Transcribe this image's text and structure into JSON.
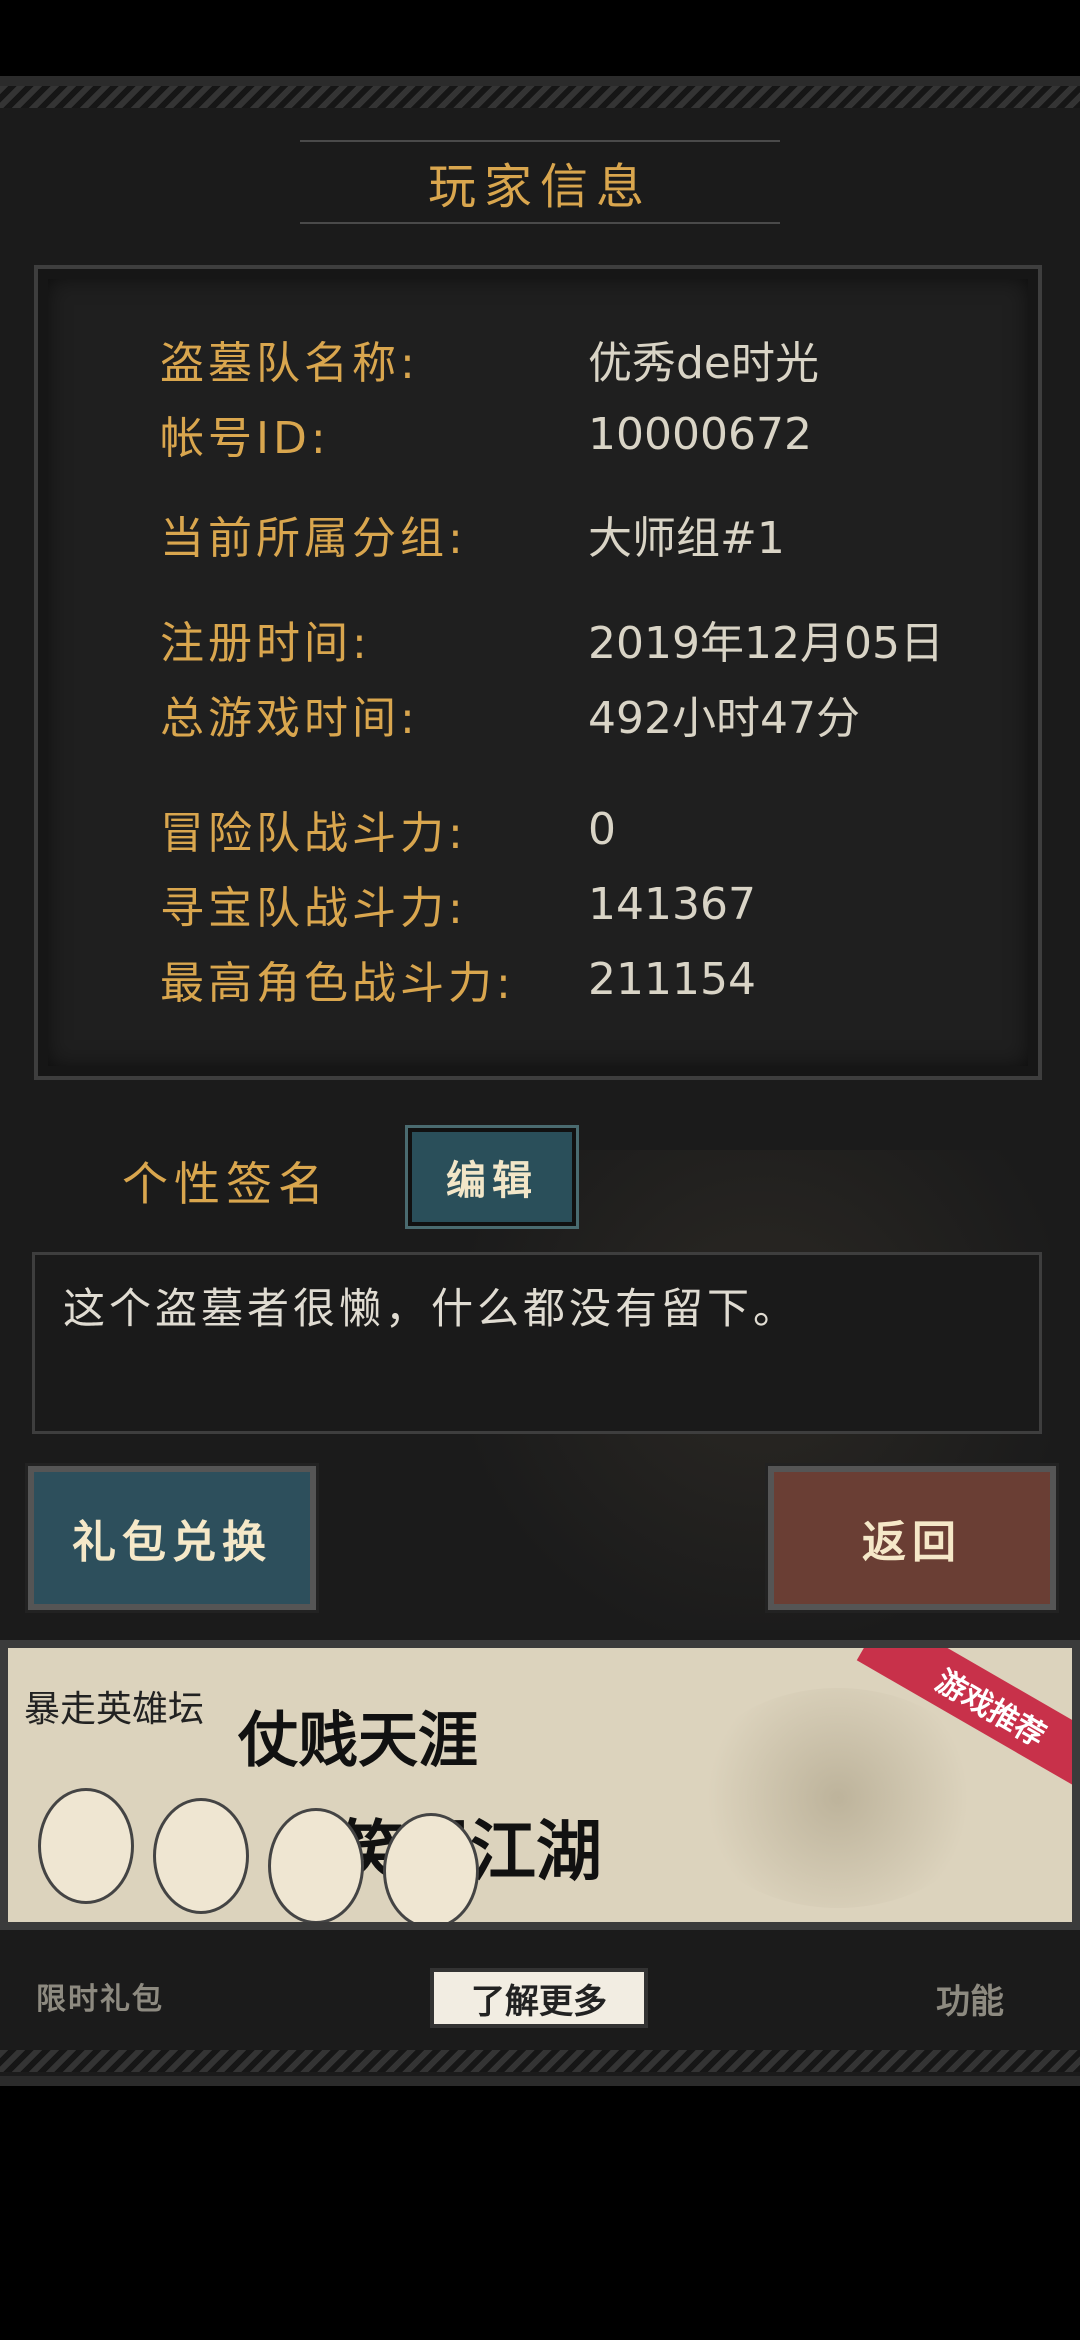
{
  "header": {
    "title": "玩家信息"
  },
  "info": {
    "rows": [
      {
        "label": "盗墓队名称:",
        "value": "优秀de时光"
      },
      {
        "label": "帐号ID:",
        "value": "10000672"
      },
      {
        "label": "当前所属分组:",
        "value": "大师组#1"
      },
      {
        "label": "注册时间:",
        "value": "2019年12月05日"
      },
      {
        "label": "总游戏时间:",
        "value": "492小时47分"
      },
      {
        "label": "冒险队战斗力:",
        "value": "0"
      },
      {
        "label": "寻宝队战斗力:",
        "value": "141367"
      },
      {
        "label": "最高角色战斗力:",
        "value": "211154"
      }
    ]
  },
  "signature": {
    "label": "个性签名",
    "edit_label": "编辑",
    "text": "这个盗墓者很懒，什么都没有留下。"
  },
  "actions": {
    "gift_label": "礼包兑换",
    "back_label": "返回"
  },
  "banner": {
    "brand": "暴走英雄坛",
    "line1": "仗贱天涯",
    "line2": "笑屎江湖",
    "tag": "游戏推荐"
  },
  "bottom": {
    "left_label": "限时礼包",
    "center_label": "了解更多",
    "right_label": "功能"
  }
}
